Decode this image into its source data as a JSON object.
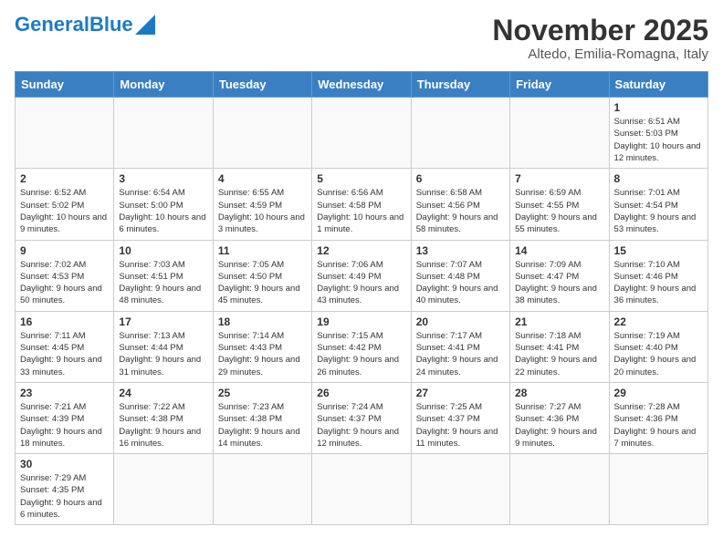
{
  "header": {
    "logo_general": "General",
    "logo_blue": "Blue",
    "title": "November 2025",
    "subtitle": "Altedo, Emilia-Romagna, Italy"
  },
  "weekdays": [
    "Sunday",
    "Monday",
    "Tuesday",
    "Wednesday",
    "Thursday",
    "Friday",
    "Saturday"
  ],
  "weeks": [
    [
      {
        "day": "",
        "info": ""
      },
      {
        "day": "",
        "info": ""
      },
      {
        "day": "",
        "info": ""
      },
      {
        "day": "",
        "info": ""
      },
      {
        "day": "",
        "info": ""
      },
      {
        "day": "",
        "info": ""
      },
      {
        "day": "1",
        "info": "Sunrise: 6:51 AM\nSunset: 5:03 PM\nDaylight: 10 hours and 12 minutes."
      }
    ],
    [
      {
        "day": "2",
        "info": "Sunrise: 6:52 AM\nSunset: 5:02 PM\nDaylight: 10 hours and 9 minutes."
      },
      {
        "day": "3",
        "info": "Sunrise: 6:54 AM\nSunset: 5:00 PM\nDaylight: 10 hours and 6 minutes."
      },
      {
        "day": "4",
        "info": "Sunrise: 6:55 AM\nSunset: 4:59 PM\nDaylight: 10 hours and 3 minutes."
      },
      {
        "day": "5",
        "info": "Sunrise: 6:56 AM\nSunset: 4:58 PM\nDaylight: 10 hours and 1 minute."
      },
      {
        "day": "6",
        "info": "Sunrise: 6:58 AM\nSunset: 4:56 PM\nDaylight: 9 hours and 58 minutes."
      },
      {
        "day": "7",
        "info": "Sunrise: 6:59 AM\nSunset: 4:55 PM\nDaylight: 9 hours and 55 minutes."
      },
      {
        "day": "8",
        "info": "Sunrise: 7:01 AM\nSunset: 4:54 PM\nDaylight: 9 hours and 53 minutes."
      }
    ],
    [
      {
        "day": "9",
        "info": "Sunrise: 7:02 AM\nSunset: 4:53 PM\nDaylight: 9 hours and 50 minutes."
      },
      {
        "day": "10",
        "info": "Sunrise: 7:03 AM\nSunset: 4:51 PM\nDaylight: 9 hours and 48 minutes."
      },
      {
        "day": "11",
        "info": "Sunrise: 7:05 AM\nSunset: 4:50 PM\nDaylight: 9 hours and 45 minutes."
      },
      {
        "day": "12",
        "info": "Sunrise: 7:06 AM\nSunset: 4:49 PM\nDaylight: 9 hours and 43 minutes."
      },
      {
        "day": "13",
        "info": "Sunrise: 7:07 AM\nSunset: 4:48 PM\nDaylight: 9 hours and 40 minutes."
      },
      {
        "day": "14",
        "info": "Sunrise: 7:09 AM\nSunset: 4:47 PM\nDaylight: 9 hours and 38 minutes."
      },
      {
        "day": "15",
        "info": "Sunrise: 7:10 AM\nSunset: 4:46 PM\nDaylight: 9 hours and 36 minutes."
      }
    ],
    [
      {
        "day": "16",
        "info": "Sunrise: 7:11 AM\nSunset: 4:45 PM\nDaylight: 9 hours and 33 minutes."
      },
      {
        "day": "17",
        "info": "Sunrise: 7:13 AM\nSunset: 4:44 PM\nDaylight: 9 hours and 31 minutes."
      },
      {
        "day": "18",
        "info": "Sunrise: 7:14 AM\nSunset: 4:43 PM\nDaylight: 9 hours and 29 minutes."
      },
      {
        "day": "19",
        "info": "Sunrise: 7:15 AM\nSunset: 4:42 PM\nDaylight: 9 hours and 26 minutes."
      },
      {
        "day": "20",
        "info": "Sunrise: 7:17 AM\nSunset: 4:41 PM\nDaylight: 9 hours and 24 minutes."
      },
      {
        "day": "21",
        "info": "Sunrise: 7:18 AM\nSunset: 4:41 PM\nDaylight: 9 hours and 22 minutes."
      },
      {
        "day": "22",
        "info": "Sunrise: 7:19 AM\nSunset: 4:40 PM\nDaylight: 9 hours and 20 minutes."
      }
    ],
    [
      {
        "day": "23",
        "info": "Sunrise: 7:21 AM\nSunset: 4:39 PM\nDaylight: 9 hours and 18 minutes."
      },
      {
        "day": "24",
        "info": "Sunrise: 7:22 AM\nSunset: 4:38 PM\nDaylight: 9 hours and 16 minutes."
      },
      {
        "day": "25",
        "info": "Sunrise: 7:23 AM\nSunset: 4:38 PM\nDaylight: 9 hours and 14 minutes."
      },
      {
        "day": "26",
        "info": "Sunrise: 7:24 AM\nSunset: 4:37 PM\nDaylight: 9 hours and 12 minutes."
      },
      {
        "day": "27",
        "info": "Sunrise: 7:25 AM\nSunset: 4:37 PM\nDaylight: 9 hours and 11 minutes."
      },
      {
        "day": "28",
        "info": "Sunrise: 7:27 AM\nSunset: 4:36 PM\nDaylight: 9 hours and 9 minutes."
      },
      {
        "day": "29",
        "info": "Sunrise: 7:28 AM\nSunset: 4:36 PM\nDaylight: 9 hours and 7 minutes."
      }
    ],
    [
      {
        "day": "30",
        "info": "Sunrise: 7:29 AM\nSunset: 4:35 PM\nDaylight: 9 hours and 6 minutes."
      },
      {
        "day": "",
        "info": ""
      },
      {
        "day": "",
        "info": ""
      },
      {
        "day": "",
        "info": ""
      },
      {
        "day": "",
        "info": ""
      },
      {
        "day": "",
        "info": ""
      },
      {
        "day": "",
        "info": ""
      }
    ]
  ]
}
